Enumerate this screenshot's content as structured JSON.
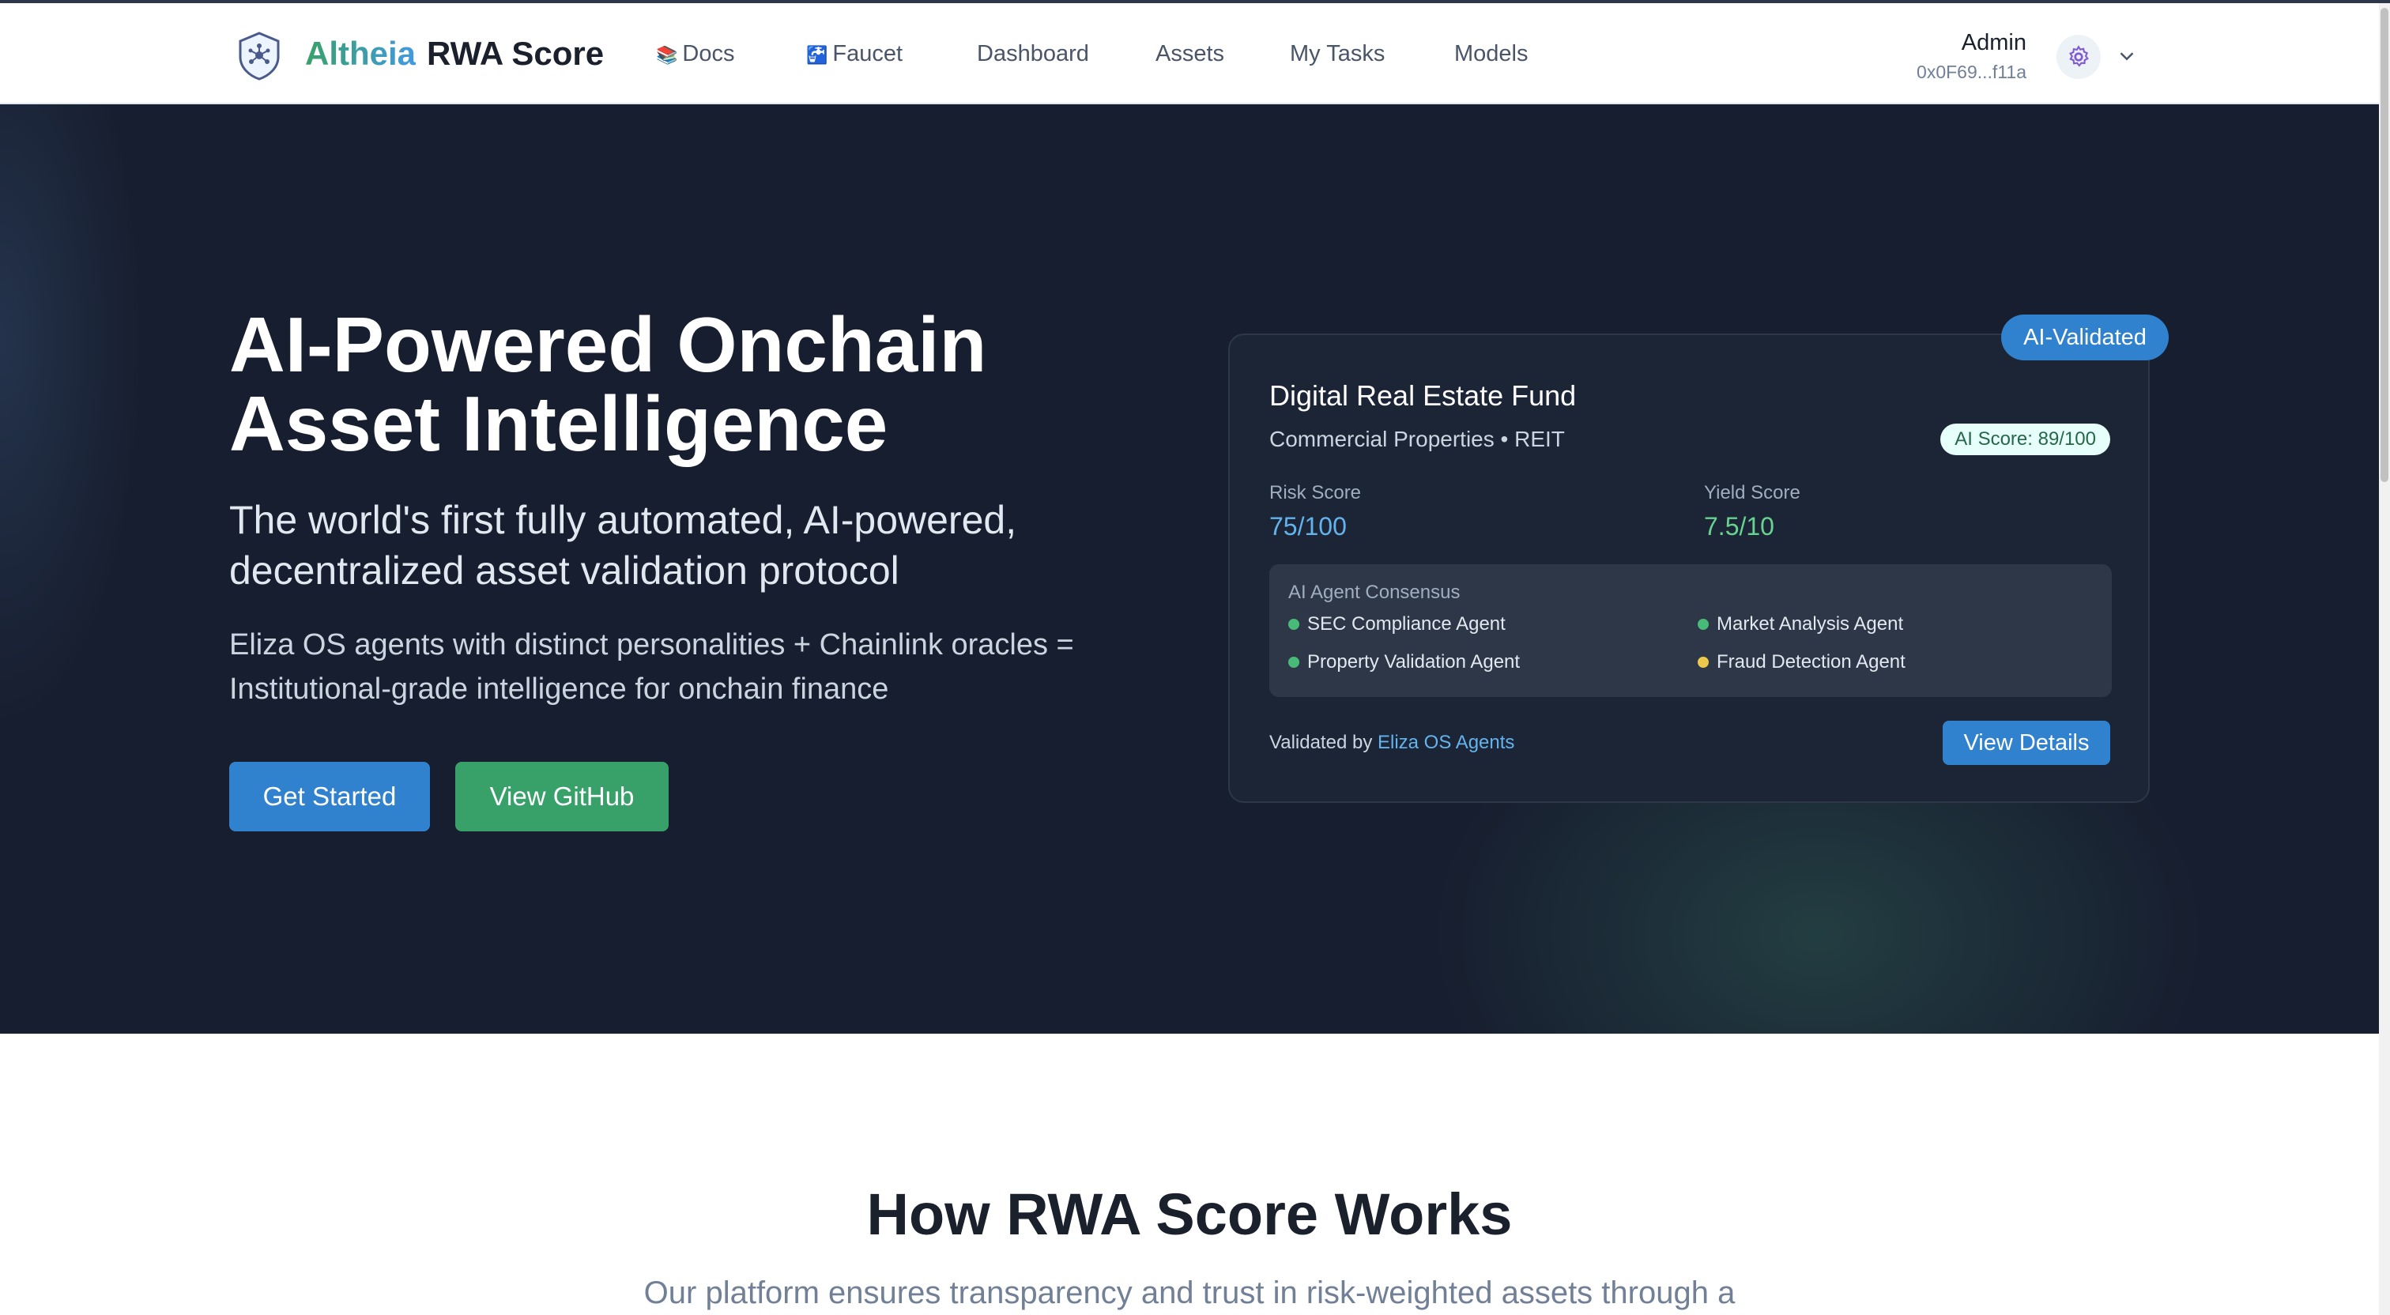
{
  "header": {
    "brand_part1": "Altheia",
    "brand_part2": "RWA Score",
    "nav": [
      {
        "label": "Docs",
        "icon": "📚"
      },
      {
        "label": "Faucet",
        "icon": "🚰"
      },
      {
        "label": "Dashboard"
      },
      {
        "label": "Assets"
      },
      {
        "label": "My Tasks"
      },
      {
        "label": "Models"
      }
    ],
    "user_name": "Admin",
    "user_address": "0x0F69...f11a"
  },
  "hero": {
    "title_line1": "AI-Powered Onchain",
    "title_line2": "Asset Intelligence",
    "subtitle": "The world's first fully automated, AI-powered, decentralized asset validation protocol",
    "description": "Eliza OS agents with distinct personalities + Chainlink oracles = Institutional-grade intelligence for onchain finance",
    "primary_button": "Get Started",
    "secondary_button": "View GitHub"
  },
  "card": {
    "badge": "AI-Validated",
    "title": "Digital Real Estate Fund",
    "subtitle": "Commercial Properties • REIT",
    "ai_score": "AI Score: 89/100",
    "risk_label": "Risk Score",
    "risk_value": "75/100",
    "yield_label": "Yield Score",
    "yield_value": "7.5/10",
    "consensus_title": "AI Agent Consensus",
    "agents": [
      {
        "name": "SEC Compliance Agent",
        "status_color": "#48bb78"
      },
      {
        "name": "Market Analysis Agent",
        "status_color": "#48bb78"
      },
      {
        "name": "Property Validation Agent",
        "status_color": "#48bb78"
      },
      {
        "name": "Fraud Detection Agent",
        "status_color": "#ecc94b"
      }
    ],
    "validated_by_prefix": "Validated by",
    "validated_by_link": "Eliza OS Agents",
    "details_button": "View Details"
  },
  "section": {
    "title": "How RWA Score Works",
    "subtitle": "Our platform ensures transparency and trust in risk-weighted assets through a"
  },
  "colors": {
    "accent_blue": "#3182ce",
    "accent_green": "#38a169",
    "hero_bg": "#171e2f"
  }
}
